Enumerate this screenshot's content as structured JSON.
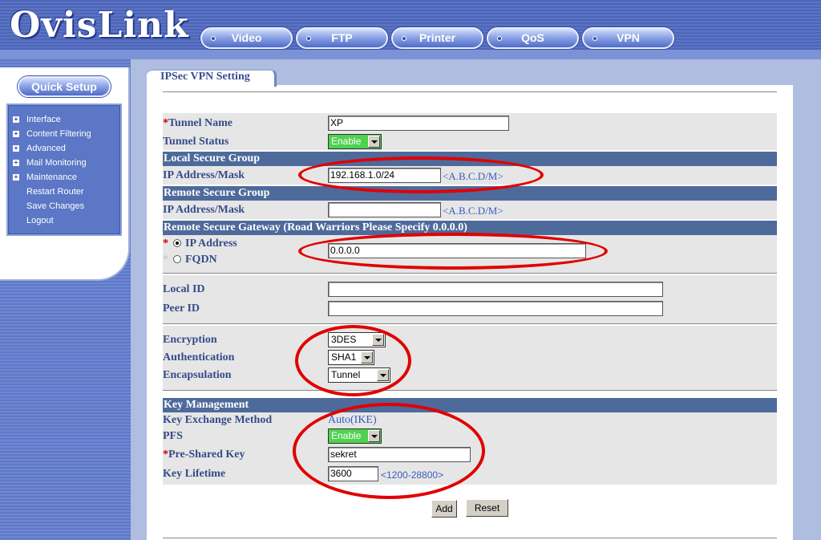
{
  "brand": "OvisLink",
  "nav": [
    "Video",
    "FTP",
    "Printer",
    "QoS",
    "VPN"
  ],
  "sidebar": {
    "quick_setup": "Quick Setup",
    "items": [
      {
        "label": "Interface",
        "expandable": true
      },
      {
        "label": "Content Filtering",
        "expandable": true
      },
      {
        "label": "Advanced",
        "expandable": true
      },
      {
        "label": "Mail Monitoring",
        "expandable": true
      },
      {
        "label": "Maintenance",
        "expandable": true
      },
      {
        "label": "Restart Router",
        "expandable": false
      },
      {
        "label": "Save Changes",
        "expandable": false
      },
      {
        "label": "Logout",
        "expandable": false
      }
    ]
  },
  "tab": "IPSec VPN Setting",
  "form": {
    "tunnel_name_label": "Tunnel Name",
    "tunnel_name_value": "XP",
    "tunnel_status_label": "Tunnel Status",
    "tunnel_status_value": "Enable",
    "local_group_head": "Local Secure Group",
    "local_ip_label": "IP Address/Mask",
    "local_ip_value": "192.168.1.0/24",
    "ip_hint": "<A.B.C.D/M>",
    "remote_group_head": "Remote Secure Group",
    "remote_ip_label": "IP Address/Mask",
    "remote_ip_value": "",
    "gateway_head": "Remote Secure Gateway (Road Warriors Please Specify 0.0.0.0)",
    "gw_ip_label": "IP Address",
    "gw_fqdn_label": "FQDN",
    "gw_value": "0.0.0.0",
    "local_id_label": "Local ID",
    "local_id_value": "",
    "peer_id_label": "Peer ID",
    "peer_id_value": "",
    "encryption_label": "Encryption",
    "encryption_value": "3DES",
    "authentication_label": "Authentication",
    "authentication_value": "SHA1",
    "encapsulation_label": "Encapsulation",
    "encapsulation_value": "Tunnel",
    "key_head": "Key Management",
    "kem_label": "Key Exchange Method",
    "kem_value": "Auto(IKE)",
    "pfs_label": "PFS",
    "pfs_value": "Enable",
    "psk_label": "Pre-Shared Key",
    "psk_value": "sekret",
    "lifetime_label": "Key Lifetime",
    "lifetime_value": "3600",
    "lifetime_hint": "<1200-28800>",
    "required_mark": "*"
  },
  "buttons": {
    "add": "Add",
    "reset": "Reset"
  },
  "colors": {
    "section_header": "#4e6a9b",
    "label_text": "#364b8a",
    "annotation_oval": "#e10000",
    "enable_select": "#4fd24f"
  }
}
